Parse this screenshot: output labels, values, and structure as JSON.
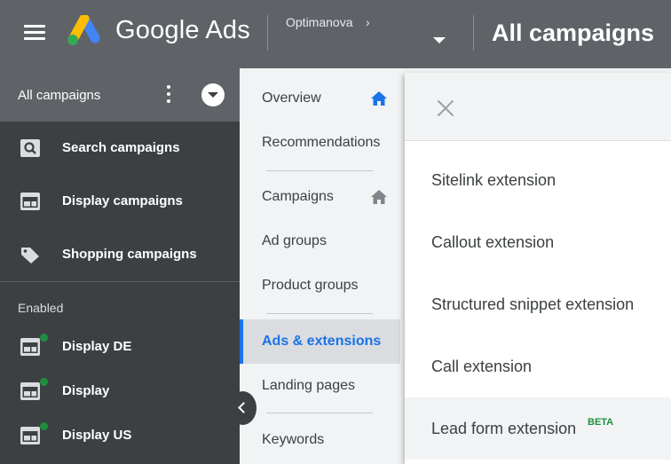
{
  "header": {
    "app_name": "Google Ads",
    "account_name": "Optimanova",
    "account_chevron": "›",
    "page_title": "All campaigns",
    "menu_icon": "hamburger-icon",
    "logo_colors": [
      "#4285f4",
      "#fbbc04",
      "#34a853"
    ]
  },
  "sidebar": {
    "header_label": "All campaigns",
    "items": [
      {
        "label": "Search campaigns",
        "icon": "search-campaign-icon"
      },
      {
        "label": "Display campaigns",
        "icon": "display-campaign-icon"
      },
      {
        "label": "Shopping campaigns",
        "icon": "shopping-tag-icon"
      }
    ],
    "section_label": "Enabled",
    "campaigns": [
      {
        "label": "Display DE",
        "status": "enabled"
      },
      {
        "label": "Display",
        "status": "enabled"
      },
      {
        "label": "Display US",
        "status": "enabled"
      }
    ],
    "status_color": "#1e8e3e"
  },
  "nav": {
    "items": [
      {
        "label": "Overview",
        "icon": "home-icon"
      },
      {
        "label": "Recommendations"
      },
      {
        "label": "Campaigns",
        "icon": "home-icon"
      },
      {
        "label": "Ad groups"
      },
      {
        "label": "Product groups"
      },
      {
        "label": "Ads & extensions",
        "active": true
      },
      {
        "label": "Landing pages"
      },
      {
        "label": "Keywords"
      }
    ],
    "accent": "#1a73e8"
  },
  "extensions_panel": {
    "items": [
      {
        "label": "Sitelink extension"
      },
      {
        "label": "Callout extension"
      },
      {
        "label": "Structured snippet extension"
      },
      {
        "label": "Call extension"
      },
      {
        "label": "Lead form extension",
        "badge": "BETA"
      }
    ]
  }
}
